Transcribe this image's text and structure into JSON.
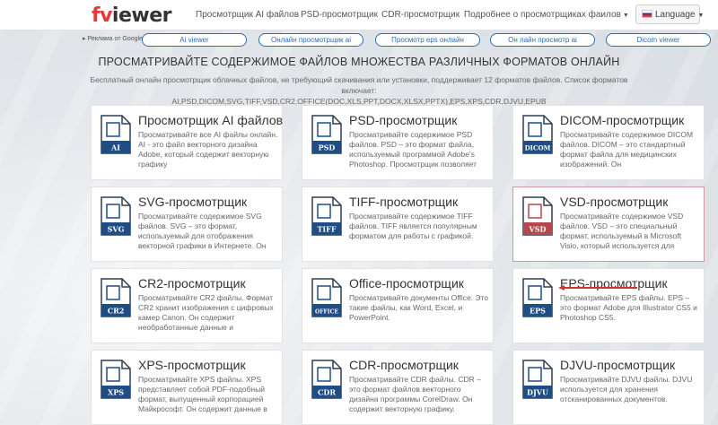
{
  "header": {
    "logo": {
      "part1": "fv",
      "part2": "iewer"
    },
    "nav": [
      {
        "label": "Просмотрщик AI файлов"
      },
      {
        "label": "PSD-просмотрщик"
      },
      {
        "label": "CDR-просмотрщик"
      },
      {
        "label": "Подробнее о просмотрщиках фаилов",
        "has_caret": true
      }
    ],
    "language_label": "Language"
  },
  "ads": {
    "label": "Реклама от Google",
    "links": [
      "Ai viewer",
      "Онлайн просмотрщик ai",
      "Просмотр eps онлайн",
      "Он лайн просмотр ai",
      "Dicom viewer"
    ]
  },
  "main": {
    "title": "ПРОСМАТРИВАЙТЕ СОДЕРЖИМОЕ ФАЙЛОВ МНОЖЕСТВА РАЗЛИЧНЫХ ФОРМАТОВ ОНЛАЙН",
    "subtitle_line1": "Бесплатный онлайн просмотрщик облачных файлов, не требующий скачивания или установки, поддерживает 12 форматов файлов. Список форматов включает:",
    "subtitle_line2": "AI,PSD,DICOM,SVG,TIFF,VSD,CR2,OFFICE(DOC,XLS,PPT,DOCX,XLSX,PPTX),EPS,XPS,CDR,DJVU,EPUB"
  },
  "cards": [
    {
      "format": "AI",
      "icon": "ai-file-icon",
      "title": "Просмотрщик AI файлов",
      "desc": "Просматривайте все AI файлы онлайн. AI - это файл векторного дизайна Adobe, который содержит векторную графику"
    },
    {
      "format": "PSD",
      "icon": "psd-file-icon",
      "title": "PSD-просмотрщик",
      "desc": "Просматривайте содержимое PSD файлов. PSD – это формат файла, используемый программой Adobe's Photoshop. Просмотрщик позволяет"
    },
    {
      "format": "DICOM",
      "icon": "dicom-file-icon",
      "title": "DICOM-просмотрщик",
      "desc": "Просматривайте содержимое DICOM файлов. DICOM – это стандартный формат файла для медицинских изображений. Он"
    },
    {
      "format": "SVG",
      "icon": "svg-file-icon",
      "title": "SVG-просмотрщик",
      "desc": "Просматривайте содержимое SVG файлов. SVG – это формат, используемый для отображения векторной графики в Интернете. Он"
    },
    {
      "format": "TIFF",
      "icon": "tiff-file-icon",
      "title": "TIFF-просмотрщик",
      "desc": "Просматривайте содержимое TIFF файлов. TIFF является популярным форматом для работы с графикой."
    },
    {
      "format": "VSD",
      "icon": "vsd-file-icon",
      "title": "VSD-просмотрщик",
      "desc": "Просматривайте содержимое VSD файлов. VSD – это специальный формат, используемый в Microsoft Visio, который используется для"
    },
    {
      "format": "CR2",
      "icon": "cr2-file-icon",
      "title": "CR2-просмотрщик",
      "desc": "Просматривайте CR2 файлы. Формат CR2 хранит изображения с цифровых камер Canon. Он содержит необработанные данные и"
    },
    {
      "format": "OFFICE",
      "icon": "office-file-icon",
      "title": "Office-просмотрщик",
      "desc": "Просматривайте документы Office. Это такие файлы, как Word, Excel, и PowerPoint."
    },
    {
      "format": "EPS",
      "icon": "eps-file-icon",
      "title": "EPS-просмотрщик",
      "desc": "Просматривайте EPS файлы. EPS – это формат Adobe для Illustrator CS5 и Photoshop CS5."
    },
    {
      "format": "XPS",
      "icon": "xps-file-icon",
      "title": "XPS-просмотрщик",
      "desc": "Просматривайте XPS файлы. XPS представляет собой PDF-подобный формат, выпущенный корпорацией Майкрософт. Он содержит данные в"
    },
    {
      "format": "CDR",
      "icon": "cdr-file-icon",
      "title": "CDR-просмотрщик",
      "desc": "Просматривайте CDR файлы. CDR – это формат файлов векторного дизайна программы CorelDraw. Он содержит векторную графику."
    },
    {
      "format": "DJVU",
      "icon": "djvu-file-icon",
      "title": "DJVU-просмотрщик",
      "desc": "Просматривайте DJVU файлы. DJVU используется для хранения отсканированных документов."
    }
  ],
  "colors": {
    "accent": "#2e6db4",
    "logo_red": "#e53935",
    "icon_blue": "#1f4e86",
    "icon_red": "#b5474d",
    "highlight_border": "#d09aa1",
    "arrow_red": "#d32f2f"
  }
}
